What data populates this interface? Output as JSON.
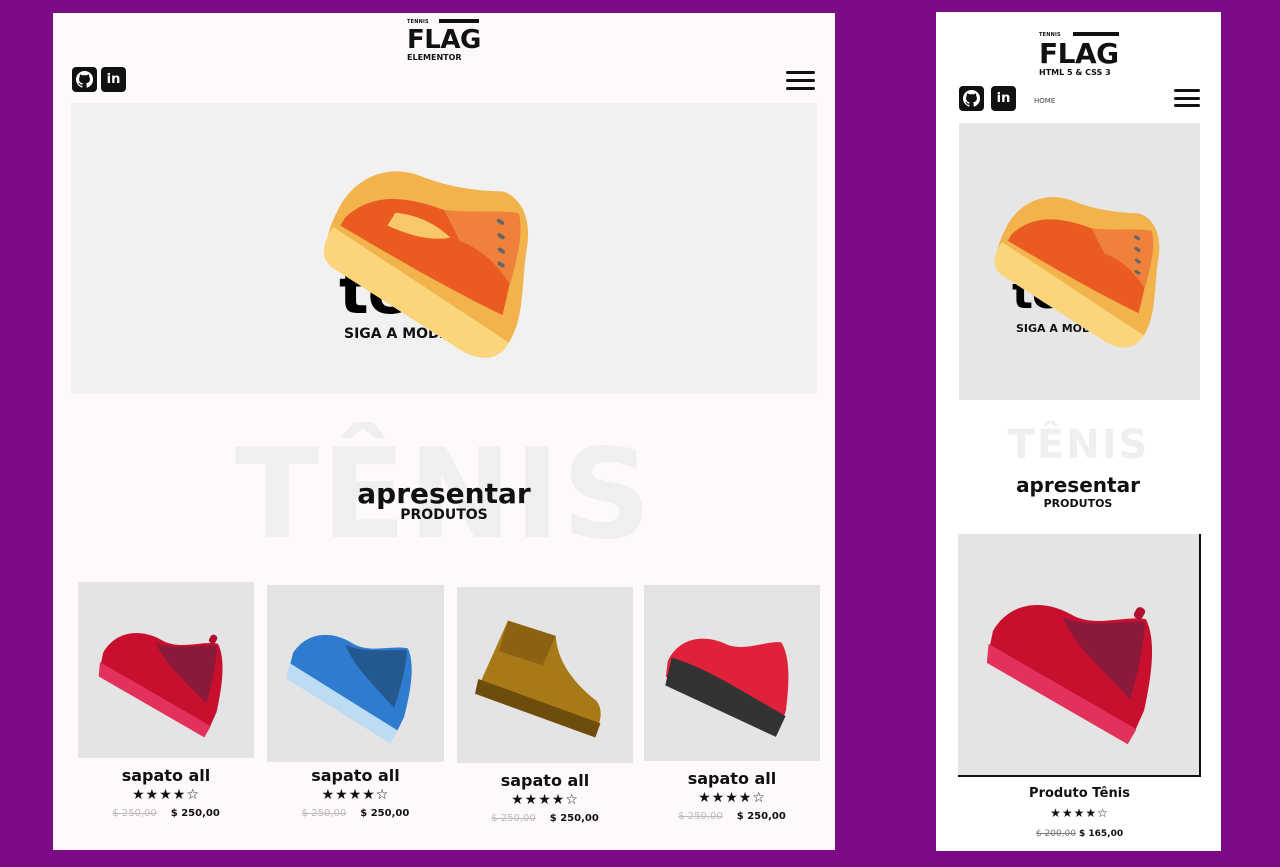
{
  "desktop": {
    "logo": {
      "small": "TENNIS",
      "big": "FLAG",
      "sub": "ELEMENTOR"
    },
    "hero": {
      "title": "tênis",
      "subtitle": "SIGA A MODA"
    },
    "section": {
      "watermark": "TÊNIS",
      "title": "apresentar",
      "subtitle": "PRODUTOS"
    },
    "products": [
      {
        "name": "sapato all",
        "stars": "★★★★☆",
        "old_price": "$ 250,00",
        "price": "$ 250,00",
        "color": "red"
      },
      {
        "name": "sapato all",
        "stars": "★★★★☆",
        "old_price": "$ 250,00",
        "price": "$ 250,00",
        "color": "blue"
      },
      {
        "name": "sapato all",
        "stars": "★★★★☆",
        "old_price": "$ 250,00",
        "price": "$ 250,00",
        "color": "brown"
      },
      {
        "name": "sapato all",
        "stars": "★★★★☆",
        "old_price": "$ 250,00",
        "price": "$ 250,00",
        "color": "black-red"
      }
    ]
  },
  "mobile": {
    "logo": {
      "small": "TENNIS",
      "big": "FLAG",
      "sub": "HTML 5 & CSS 3"
    },
    "nav": {
      "home": "HOME"
    },
    "hero": {
      "title": "tênis",
      "subtitle": "SIGA A MODA"
    },
    "section": {
      "watermark": "TÊNIS",
      "title": "apresentar",
      "subtitle": "PRODUTOS"
    },
    "product": {
      "name": "Produto Tênis",
      "stars": "★★★★☆",
      "old_price": "$ 200,00",
      "price": "$ 165,00"
    }
  },
  "icons": {
    "github": "github-icon",
    "linkedin": "linkedin-icon",
    "menu": "hamburger-menu-icon"
  },
  "colors": {
    "background": "#7d0a86",
    "panel": "#fffafa",
    "hero": "#f1f1f1",
    "card": "#e4e4e4"
  }
}
